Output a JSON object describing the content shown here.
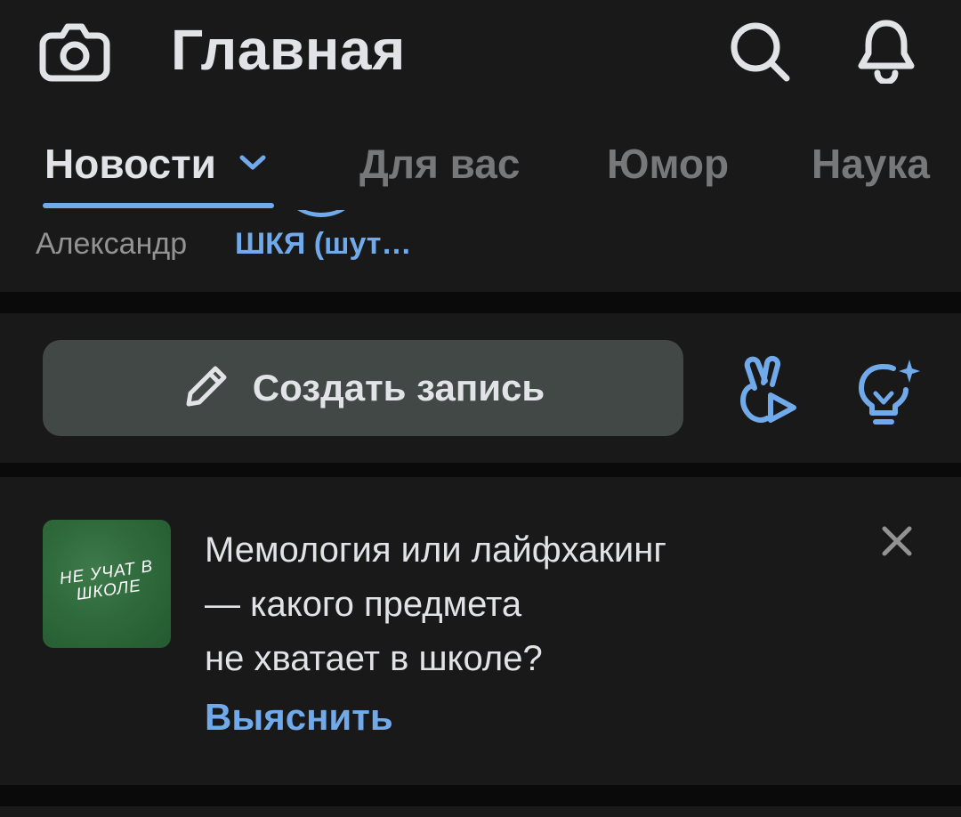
{
  "header": {
    "title": "Главная",
    "icons": {
      "camera": "camera-icon",
      "search": "search-icon",
      "notifications": "bell-icon"
    }
  },
  "tabs": [
    {
      "label": "Новости",
      "active": true
    },
    {
      "label": "Для вас",
      "active": false
    },
    {
      "label": "Юмор",
      "active": false
    },
    {
      "label": "Наука",
      "active": false
    }
  ],
  "stories": [
    {
      "label": "Александр"
    },
    {
      "label": "ШКЯ (шут…"
    }
  ],
  "composer": {
    "create_label": "Создать запись",
    "icons": [
      "pencil-icon",
      "clips-icon",
      "idea-bulb-icon"
    ]
  },
  "promo": {
    "thumbnail_text": "НЕ УЧАТ В ШКОЛЕ",
    "text_lines": [
      "Мемология или лайфхакинг",
      "— какого предмета",
      "не хватает в школе?"
    ],
    "action_label": "Выяснить",
    "close_icon": "close-icon"
  },
  "colors": {
    "background": "#0a0a0a",
    "surface": "#19191a",
    "accent": "#71aaeb",
    "text_primary": "#e1e3e6",
    "text_secondary": "#76787a",
    "button_fill": "#424846",
    "thumbnail_green": "#2f6a3c"
  }
}
